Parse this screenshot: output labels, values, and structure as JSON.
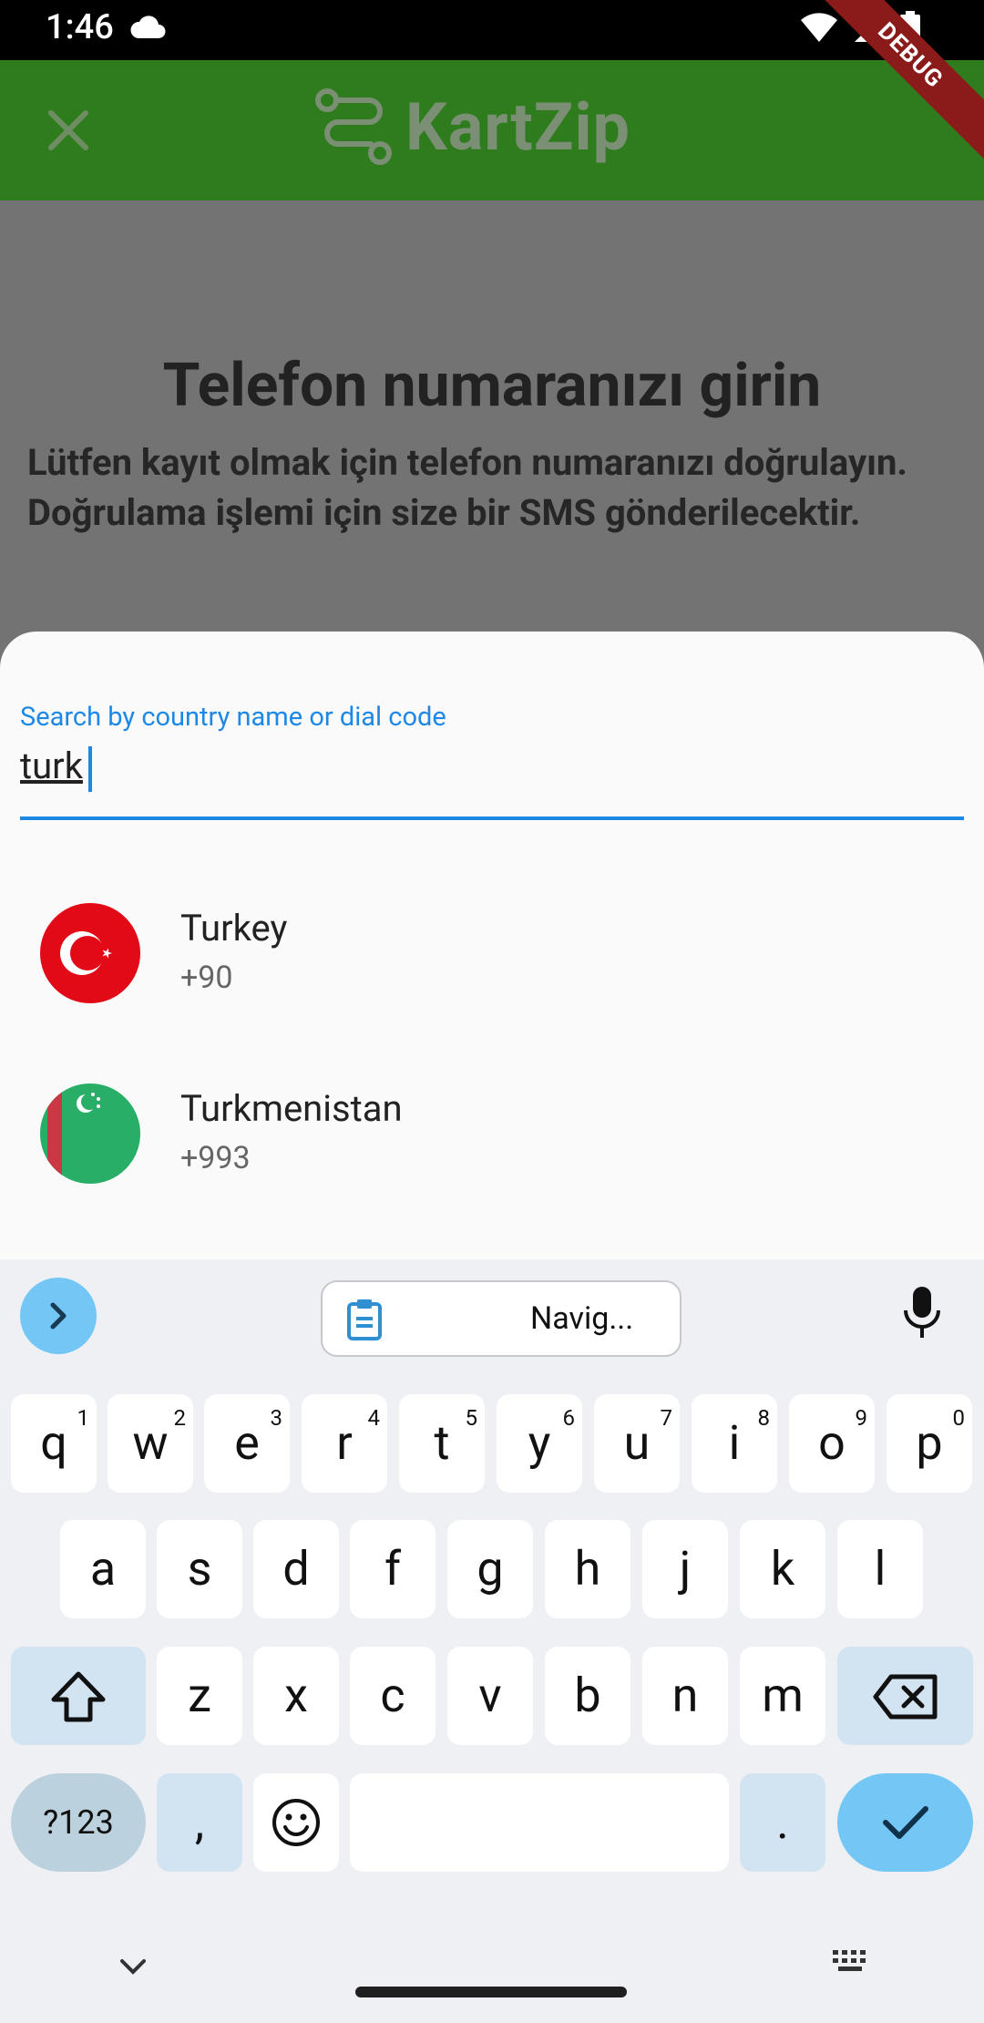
{
  "status_bar": {
    "time": "1:46"
  },
  "debug_banner": "DEBUG",
  "app_bar": {
    "brand": "KartZip"
  },
  "page": {
    "title": "Telefon numaranızı girin",
    "description": "Lütfen kayıt olmak için telefon numaranızı doğrulayın. Doğrulama işlemi için size bir SMS gönderilecektir."
  },
  "country_sheet": {
    "search_label": "Search by country name or dial code",
    "search_value": "turk",
    "countries": [
      {
        "name": "Turkey",
        "dial_code": "+90",
        "flag": "turkey-flag"
      },
      {
        "name": "Turkmenistan",
        "dial_code": "+993",
        "flag": "turkmenistan-flag"
      }
    ]
  },
  "keyboard": {
    "clipboard_label": "Navig...",
    "row1": [
      "q",
      "w",
      "e",
      "r",
      "t",
      "y",
      "u",
      "i",
      "o",
      "p"
    ],
    "row1_numbers": [
      "1",
      "2",
      "3",
      "4",
      "5",
      "6",
      "7",
      "8",
      "9",
      "0"
    ],
    "row2": [
      "a",
      "s",
      "d",
      "f",
      "g",
      "h",
      "j",
      "k",
      "l"
    ],
    "row3": [
      "z",
      "x",
      "c",
      "v",
      "b",
      "n",
      "m"
    ],
    "symbols_key": "?123",
    "comma_key": ",",
    "period_key": "."
  },
  "colors": {
    "app_bar": "#2f7c1e",
    "accent": "#1e88e5",
    "keyboard_accent": "#74c7f5"
  }
}
